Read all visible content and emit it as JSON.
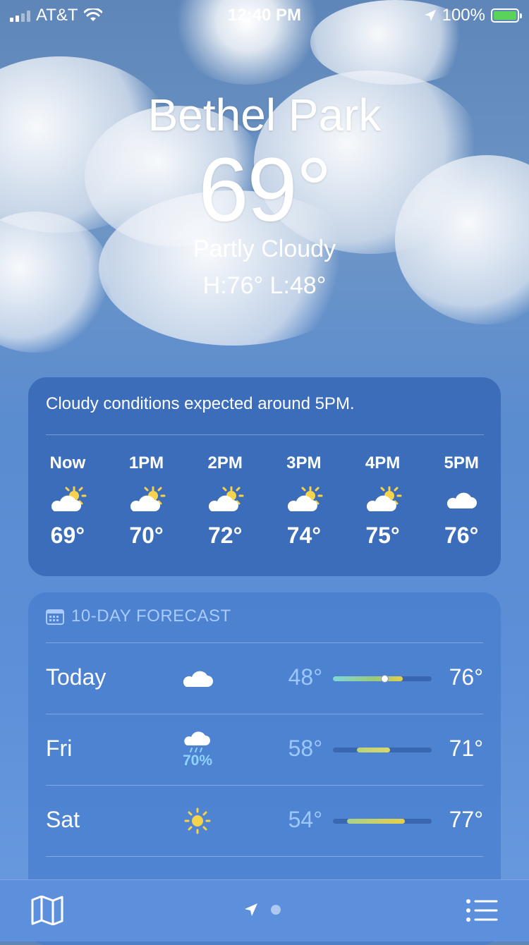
{
  "status_bar": {
    "carrier": "AT&T",
    "time": "12:40 PM",
    "battery": "100%"
  },
  "location": {
    "city": "Bethel Park",
    "temperature": "69°",
    "condition": "Partly Cloudy",
    "high_low": "H:76°  L:48°"
  },
  "hourly": {
    "summary": "Cloudy conditions expected around 5PM.",
    "hours": [
      {
        "time": "Now",
        "icon": "partly-cloudy-icon",
        "temp": "69°"
      },
      {
        "time": "1PM",
        "icon": "partly-cloudy-icon",
        "temp": "70°"
      },
      {
        "time": "2PM",
        "icon": "partly-cloudy-icon",
        "temp": "72°"
      },
      {
        "time": "3PM",
        "icon": "partly-cloudy-icon",
        "temp": "74°"
      },
      {
        "time": "4PM",
        "icon": "partly-cloudy-icon",
        "temp": "75°"
      },
      {
        "time": "5PM",
        "icon": "cloud-icon",
        "temp": "76°"
      }
    ]
  },
  "forecast": {
    "header": "10-DAY FORECAST",
    "days": [
      {
        "day": "Today",
        "icon": "cloud-icon",
        "precip": "",
        "low": "48°",
        "high": "76°",
        "range_start": 0.0,
        "range_end": 0.71,
        "current_marker": 0.52
      },
      {
        "day": "Fri",
        "icon": "rain-cloud-icon",
        "precip": "70%",
        "low": "58°",
        "high": "71°",
        "range_start": 0.24,
        "range_end": 0.58
      },
      {
        "day": "Sat",
        "icon": "sun-icon",
        "precip": "",
        "low": "54°",
        "high": "77°",
        "range_start": 0.14,
        "range_end": 0.73
      }
    ]
  },
  "colors": {
    "bar_cool": "#7fd8d8",
    "bar_warm": "#e6cf4a",
    "bar_green": "#9cc879"
  }
}
